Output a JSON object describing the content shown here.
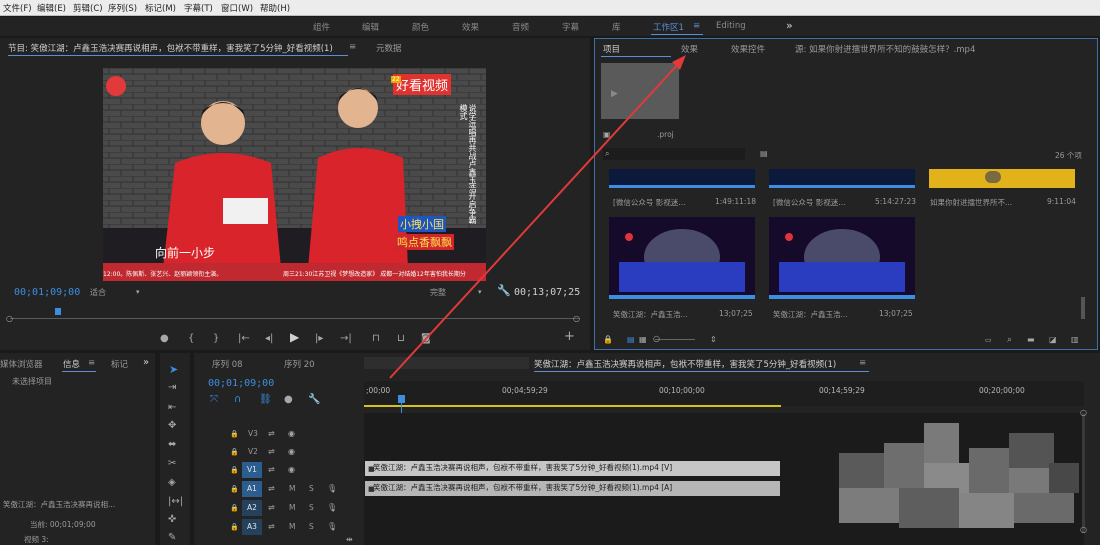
{
  "menu": [
    "文件(F)",
    "编辑(E)",
    "剪辑(C)",
    "序列(S)",
    "标记(M)",
    "字幕(T)",
    "窗口(W)",
    "帮助(H)"
  ],
  "workspaces": [
    "组件",
    "编辑",
    "颜色",
    "效果",
    "音频",
    "字幕",
    "库",
    "工作区1",
    "Editing"
  ],
  "workspace_menu_glyph": "≡",
  "workspace_more": "»",
  "source": {
    "tab_label": "节目: 笑傲江湖：卢鑫玉浩决赛再说相声，包袱不带重样，害我笑了5分钟_好看视频(1)",
    "tab_menu": "≡",
    "metadata_tab": "元数据",
    "timecode_current": "00;01;09;00",
    "fit_label": "适合",
    "quality_label": "完整",
    "timecode_duration": "00;13;07;25",
    "video": {
      "logo_text": "好看视频",
      "vertical_caption": "说学逗唱再共战卢鑫玉浩开启争霸模式",
      "subtitle": "向前一小步",
      "badge_line1": "小拽小国",
      "badge_line2": "鸣点香飘飘",
      "ticker_left": "12:00。陈佩斯、张艺兴、赵丽颖领衔主演。",
      "ticker_right": "周三21:30江苏卫视《梦想改造家》 成都一对结婚12年害怕我长期分",
      "channel_mark": "22"
    }
  },
  "project": {
    "tab_project": "项目",
    "tab_effects": "效果",
    "tab_effect_controls": "效果控件",
    "source_label": "源: 如果你射进擂世界所不知的鼓鼓怎样？.mp4",
    "project_file": ".proj",
    "item_count": "26 个项",
    "search_placeholder": "",
    "items": [
      {
        "name": "[微信公众号 影视迷...",
        "duration": "1:49:11:18"
      },
      {
        "name": "[微信公众号 影视迷...",
        "duration": "5:14:27:23"
      },
      {
        "name": "如果你射进擂世界所不...",
        "duration": "9:11:04"
      },
      {
        "name": "笑傲江湖：卢鑫玉浩...",
        "duration": "13;07;25"
      },
      {
        "name": "笑傲江湖：卢鑫玉浩...",
        "duration": "13;07;25"
      }
    ]
  },
  "info": {
    "tab_media_browser": "媒体浏览器",
    "tab_info": "信息",
    "tab_info_menu": "≡",
    "tab_markers": "标记",
    "more": "»",
    "no_selection": "未选择项目",
    "clip_name": "笑傲江湖：卢鑫玉浩决赛再说相...",
    "current_label": "当前: 00;01;09;00",
    "video_track": "视频 3:"
  },
  "timeline": {
    "tabs": [
      "序列 08",
      "序列 20",
      "笑傲江湖：卢鑫玉浩决赛再说相声，包袱不带重样，害我笑了5分钟_好看视频(1)"
    ],
    "tab_menu": "≡",
    "timecode": "00;01;09;00",
    "ruler": [
      ";00;00",
      "00;04;59;29",
      "00;10;00;00",
      "00;14;59;29",
      "00;20;00;00"
    ],
    "tracks": [
      {
        "name": "V3",
        "type": "video"
      },
      {
        "name": "V2",
        "type": "video"
      },
      {
        "name": "V1",
        "type": "video",
        "target": true
      },
      {
        "name": "A1",
        "type": "audio",
        "target": true
      },
      {
        "name": "A2",
        "type": "audio"
      },
      {
        "name": "A3",
        "type": "audio"
      }
    ],
    "mute": "M",
    "solo": "S",
    "video_clip": "笑傲江湖：卢鑫玉浩决赛再说相声，包袱不带重样，害我笑了5分钟_好看视频(1).mp4 [V]",
    "audio_clip": "笑傲江湖：卢鑫玉浩决赛再说相声，包袱不带重样，害我笑了5分钟_好看视频(1).mp4 [A]"
  },
  "colors": {
    "accent_blue": "#3d8ee0",
    "arrow_red": "#e03a3a",
    "work_area_yellow": "#d6c21e"
  }
}
